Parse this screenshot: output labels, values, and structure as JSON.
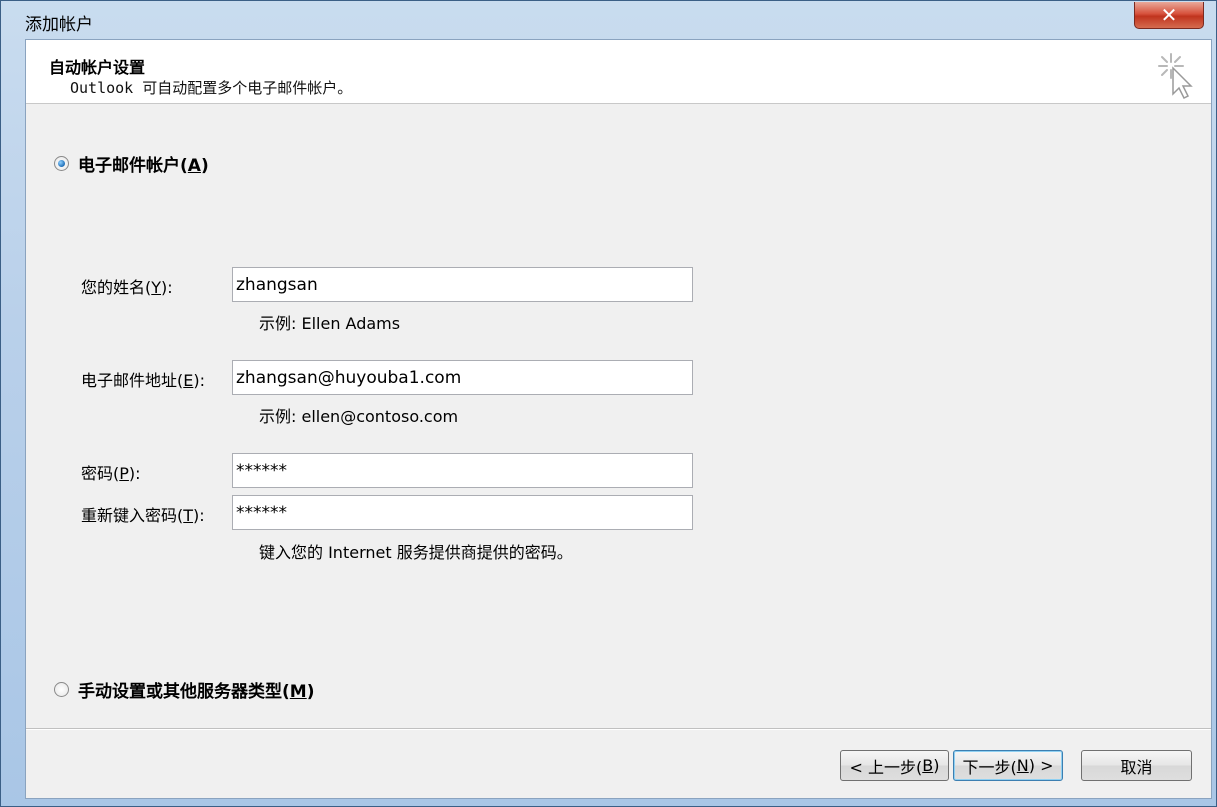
{
  "window": {
    "title": "添加帐户",
    "close_label": "✕"
  },
  "header": {
    "title": "自动帐户设置",
    "subtitle": "Outlook 可自动配置多个电子邮件帐户。"
  },
  "email_option": {
    "label_prefix": "电子邮件帐户(",
    "accel": "A",
    "label_suffix": ")",
    "checked": true
  },
  "fields": {
    "name": {
      "label_prefix": "您的姓名(",
      "accel": "Y",
      "label_suffix": "):",
      "value": "zhangsan",
      "hint": "示例: Ellen Adams"
    },
    "email": {
      "label_prefix": "电子邮件地址(",
      "accel": "E",
      "label_suffix": "):",
      "value": "zhangsan@huyouba1.com",
      "hint": "示例: ellen@contoso.com"
    },
    "password": {
      "label_prefix": "密码(",
      "accel": "P",
      "label_suffix": "):",
      "value": "******"
    },
    "retype_password": {
      "label_prefix": "重新键入密码(",
      "accel": "T",
      "label_suffix": "):",
      "value": "******",
      "hint": "键入您的 Internet 服务提供商提供的密码。"
    }
  },
  "manual_option": {
    "label_prefix": "手动设置或其他服务器类型(",
    "accel": "M",
    "label_suffix": ")",
    "checked": false
  },
  "buttons": {
    "back": {
      "prefix": "< 上一步(",
      "accel": "B",
      "suffix": ")"
    },
    "next": {
      "prefix": "下一步(",
      "accel": "N",
      "suffix": ") >"
    },
    "cancel": {
      "label": "取消"
    }
  },
  "colors": {
    "accent": "#3c7fb1",
    "close_button": "#c0341e",
    "dialog_bg": "#f0f0f0"
  }
}
